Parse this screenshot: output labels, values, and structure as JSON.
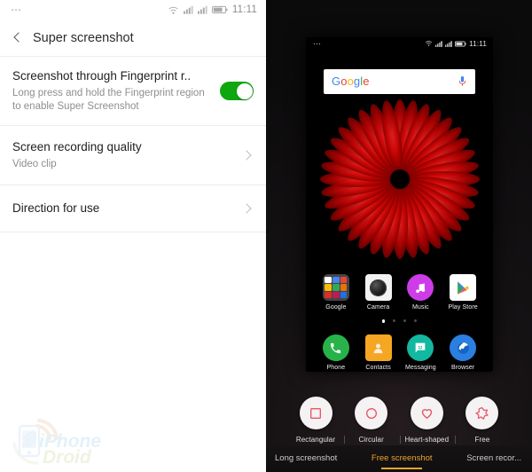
{
  "settings": {
    "status_bar": {
      "dots": "⋯",
      "icons": [
        "wifi-icon",
        "signal-icon",
        "signal-icon",
        "battery-icon"
      ],
      "time": "11:11"
    },
    "header": {
      "back_icon": "back-chevron-icon",
      "title": "Super screenshot"
    },
    "rows": [
      {
        "title": "Screenshot through Fingerprint r..",
        "subtitle": "Long press and hold the Fingerprint region to enable Super Screenshot",
        "control": "toggle",
        "toggle_on": true
      },
      {
        "title": "Screen recording quality",
        "subtitle": "Video clip",
        "control": "chevron"
      },
      {
        "title": "Direction for use",
        "subtitle": "",
        "control": "chevron"
      }
    ],
    "watermark": {
      "line1": "iPhone",
      "line2": "Droid"
    }
  },
  "phone": {
    "status_bar": {
      "dots": "⋯",
      "time": "11:11"
    },
    "search": {
      "logo_letters": [
        {
          "ch": "G",
          "color": "#4285F4"
        },
        {
          "ch": "o",
          "color": "#EA4335"
        },
        {
          "ch": "o",
          "color": "#FBBC05"
        },
        {
          "ch": "g",
          "color": "#4285F4"
        },
        {
          "ch": "l",
          "color": "#34A853"
        },
        {
          "ch": "e",
          "color": "#EA4335"
        }
      ],
      "logo_text": "Google",
      "mic_icon": "microphone-icon"
    },
    "apps_row1": [
      {
        "label": "Google",
        "icon": "google-folder-icon"
      },
      {
        "label": "Camera",
        "icon": "camera-icon"
      },
      {
        "label": "Music",
        "icon": "music-icon"
      },
      {
        "label": "Play Store",
        "icon": "play-store-icon"
      }
    ],
    "apps_row2": [
      {
        "label": "Phone",
        "icon": "phone-icon"
      },
      {
        "label": "Contacts",
        "icon": "contacts-icon"
      },
      {
        "label": "Messaging",
        "icon": "messaging-icon"
      },
      {
        "label": "Browser",
        "icon": "browser-icon"
      }
    ],
    "page_dots": {
      "count": 4,
      "active": 0
    },
    "wallpaper": {
      "name": "red-flower-wallpaper",
      "color": "#E00000"
    }
  },
  "shape_picker": [
    {
      "label": "Rectangular",
      "icon": "square-icon"
    },
    {
      "label": "Circular",
      "icon": "circle-icon"
    },
    {
      "label": "Heart-shaped",
      "icon": "heart-icon"
    },
    {
      "label": "Free",
      "icon": "star-freeform-icon"
    }
  ],
  "tabs": [
    {
      "label": "Long screenshot",
      "active": false
    },
    {
      "label": "Free screenshot",
      "active": true
    },
    {
      "label": "Screen recor...",
      "active": false
    }
  ],
  "colors": {
    "toggle_on": "#0EA80E",
    "accent_orange": "#F0A42A",
    "shape_outline": "#E8566A"
  }
}
